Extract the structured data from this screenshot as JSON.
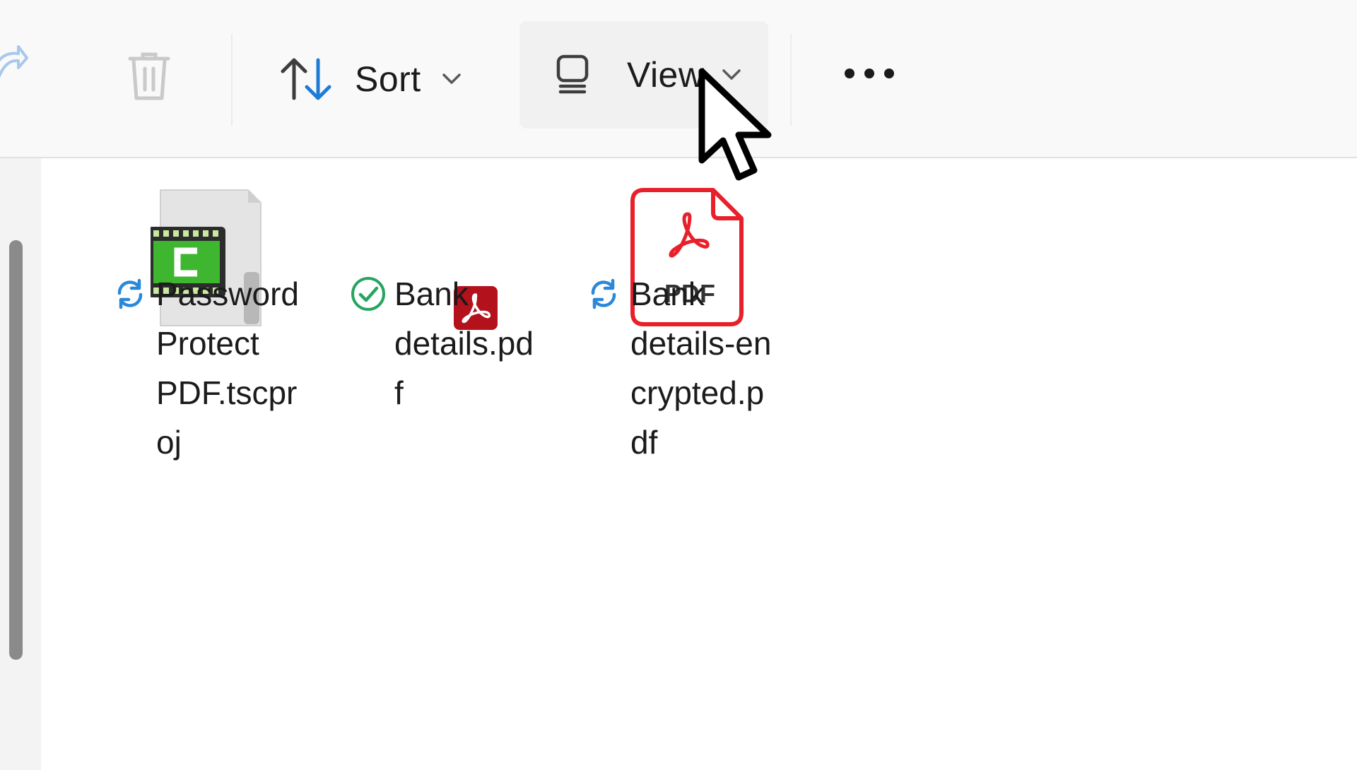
{
  "toolbar": {
    "sort_label": "Sort",
    "view_label": "View",
    "icons": [
      "share-icon",
      "delete-icon",
      "sort-icon",
      "chevron-down-icon",
      "view-icon",
      "more-icon"
    ]
  },
  "files": [
    {
      "name": "Password\nProtect\nPDF.tscpr\noj",
      "status": "sync-pending",
      "icon": "camtasia-project-icon"
    },
    {
      "name": "Bank\ndetails.pd\nf",
      "status": "synced",
      "icon": "acrobat-small-icon"
    },
    {
      "name": "Bank\ndetails-en\ncrypted.p\ndf",
      "status": "sync-pending",
      "icon": "pdf-icon",
      "pdf_badge": "PDF"
    }
  ],
  "colors": {
    "sync_blue": "#2b88d8",
    "synced_green": "#25a55f",
    "pdf_red": "#e8202a",
    "acrobat_dark_red": "#b3121c"
  }
}
